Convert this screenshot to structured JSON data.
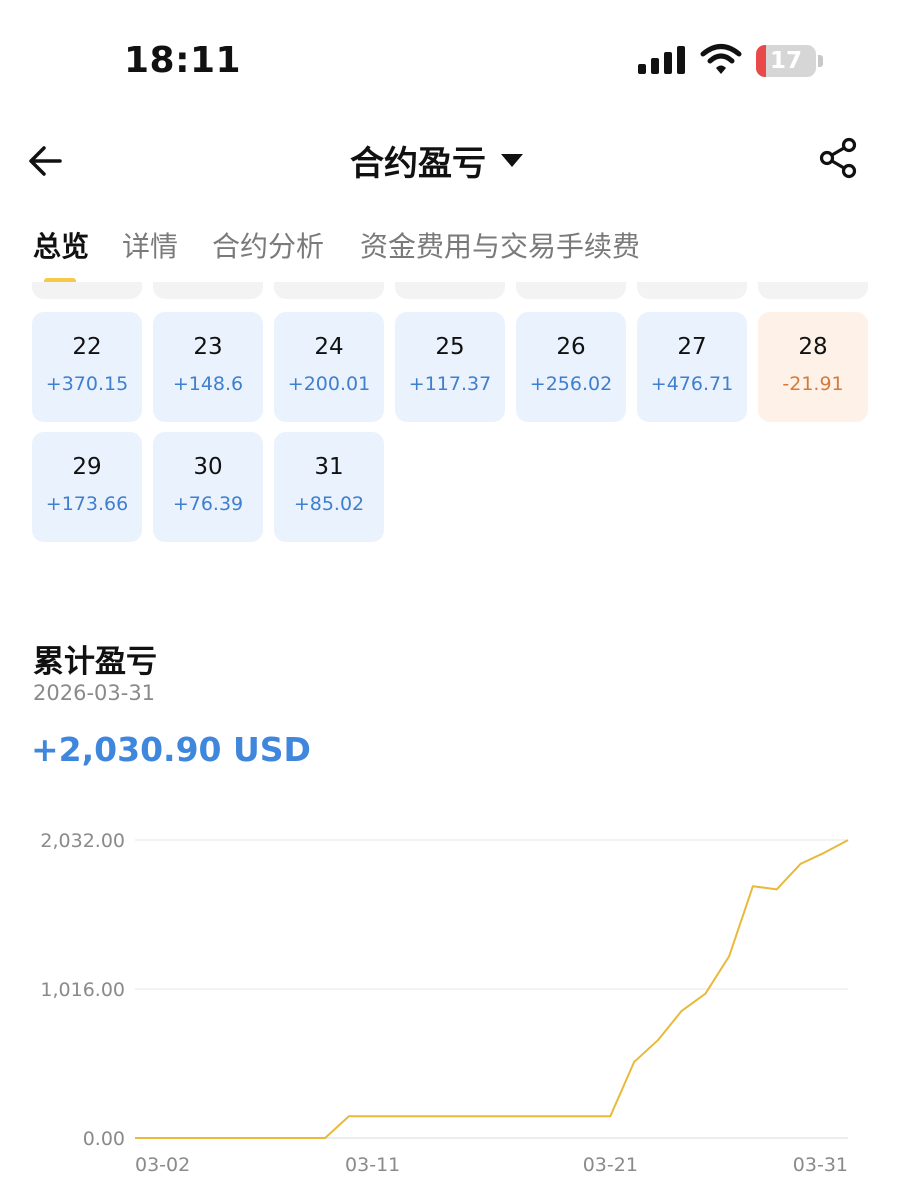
{
  "status_bar": {
    "time": "18:11",
    "battery": "17",
    "battery_level": 0.17
  },
  "nav": {
    "title": "合约盈亏"
  },
  "tabs": [
    {
      "label": "总览",
      "active": true
    },
    {
      "label": "详情",
      "active": false
    },
    {
      "label": "合约分析",
      "active": false
    },
    {
      "label": "资金费用与交易手续费",
      "active": false
    }
  ],
  "calendar": {
    "days": [
      {
        "day": "22",
        "value": "+370.15",
        "negative": false
      },
      {
        "day": "23",
        "value": "+148.6",
        "negative": false
      },
      {
        "day": "24",
        "value": "+200.01",
        "negative": false
      },
      {
        "day": "25",
        "value": "+117.37",
        "negative": false
      },
      {
        "day": "26",
        "value": "+256.02",
        "negative": false
      },
      {
        "day": "27",
        "value": "+476.71",
        "negative": false
      },
      {
        "day": "28",
        "value": "-21.91",
        "negative": true
      },
      {
        "day": "29",
        "value": "+173.66",
        "negative": false
      },
      {
        "day": "30",
        "value": "+76.39",
        "negative": false
      },
      {
        "day": "31",
        "value": "+85.02",
        "negative": false
      }
    ]
  },
  "cumulative": {
    "title": "累计盈亏",
    "date": "2026-03-31",
    "total": "+2,030.90 USD"
  },
  "colors": {
    "accent": "#f7c948",
    "positive": "#3f7fcf",
    "negative": "#d57a3a",
    "line": "#e8b93a"
  },
  "chart_data": {
    "type": "line",
    "x": [
      "03-01",
      "03-02",
      "03-03",
      "03-04",
      "03-05",
      "03-06",
      "03-07",
      "03-08",
      "03-09",
      "03-10",
      "03-11",
      "03-12",
      "03-13",
      "03-14",
      "03-15",
      "03-16",
      "03-17",
      "03-18",
      "03-19",
      "03-20",
      "03-21",
      "03-22",
      "03-23",
      "03-24",
      "03-25",
      "03-26",
      "03-27",
      "03-28",
      "03-29",
      "03-30",
      "03-31"
    ],
    "series": [
      {
        "values": [
          0,
          0,
          0,
          0,
          0,
          0,
          0,
          0,
          0,
          148,
          148,
          148,
          148,
          148,
          148,
          148,
          148,
          148,
          148,
          148,
          148,
          518,
          667,
          867,
          984,
          1240,
          1717,
          1695,
          1869,
          1945,
          2031
        ]
      }
    ],
    "x_tick_labels": [
      "03-02",
      "03-11",
      "03-21",
      "03-31"
    ],
    "y_tick_labels": [
      "2,032.00",
      "1,016.00",
      "0.00"
    ],
    "y_ticks": [
      2032,
      1016,
      0
    ],
    "ylim": [
      0,
      2032
    ],
    "grid": true
  }
}
